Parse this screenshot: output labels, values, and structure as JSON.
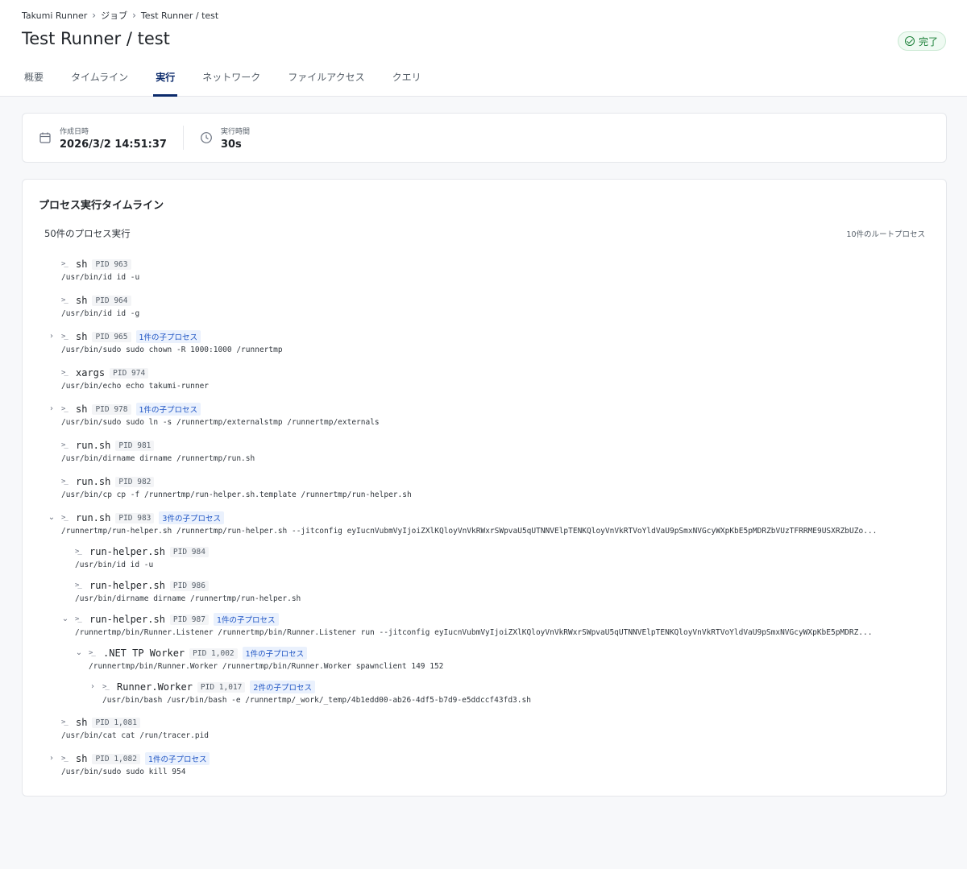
{
  "breadcrumb": {
    "items": [
      "Takumi Runner",
      "ジョブ",
      "Test Runner / test"
    ]
  },
  "page": {
    "title": "Test Runner / test",
    "status": "完了"
  },
  "tabs": [
    "概要",
    "タイムライン",
    "実行",
    "ネットワーク",
    "ファイルアクセス",
    "クエリ"
  ],
  "active_tab": "実行",
  "meta": {
    "created_label": "作成日時",
    "created_value": "2026/3/2 14:51:37",
    "duration_label": "実行時間",
    "duration_value": "30s"
  },
  "timeline": {
    "title": "プロセス実行タイムライン",
    "count": "50件のプロセス実行",
    "roots": "10件のルートプロセス",
    "processes": [
      {
        "name": "sh",
        "pid": "PID 963",
        "children": "",
        "cmd": "/usr/bin/id id -u",
        "toggle": ""
      },
      {
        "name": "sh",
        "pid": "PID 964",
        "children": "",
        "cmd": "/usr/bin/id id -g",
        "toggle": ""
      },
      {
        "name": "sh",
        "pid": "PID 965",
        "children": "1件の子プロセス",
        "cmd": "/usr/bin/sudo sudo chown -R 1000:1000 /runnertmp",
        "toggle": "›"
      },
      {
        "name": "xargs",
        "pid": "PID 974",
        "children": "",
        "cmd": "/usr/bin/echo echo takumi-runner",
        "toggle": ""
      },
      {
        "name": "sh",
        "pid": "PID 978",
        "children": "1件の子プロセス",
        "cmd": "/usr/bin/sudo sudo ln -s /runnertmp/externalstmp /runnertmp/externals",
        "toggle": "›"
      },
      {
        "name": "run.sh",
        "pid": "PID 981",
        "children": "",
        "cmd": "/usr/bin/dirname dirname /runnertmp/run.sh",
        "toggle": ""
      },
      {
        "name": "run.sh",
        "pid": "PID 982",
        "children": "",
        "cmd": "/usr/bin/cp cp -f /runnertmp/run-helper.sh.template /runnertmp/run-helper.sh",
        "toggle": ""
      },
      {
        "name": "run.sh",
        "pid": "PID 983",
        "children": "3件の子プロセス",
        "cmd": "/runnertmp/run-helper.sh /runnertmp/run-helper.sh --jitconfig eyIucnVubmVyIjoiZXlKQloyVnVkRWxrSWpvaU5qUTNNVElpTENKQloyVnVkRTVoYldVaU9pSmxNVGcyWXpKbE5pMDRZbVUzTFRRME9USXRZbUZo...",
        "toggle": "⌄"
      },
      {
        "name": "run-helper.sh",
        "pid": "PID 984",
        "children": "",
        "cmd": "/usr/bin/id id -u",
        "toggle": ""
      },
      {
        "name": "run-helper.sh",
        "pid": "PID 986",
        "children": "",
        "cmd": "/usr/bin/dirname dirname /runnertmp/run-helper.sh",
        "toggle": ""
      },
      {
        "name": "run-helper.sh",
        "pid": "PID 987",
        "children": "1件の子プロセス",
        "cmd": "/runnertmp/bin/Runner.Listener /runnertmp/bin/Runner.Listener run --jitconfig eyIucnVubmVyIjoiZXlKQloyVnVkRWxrSWpvaU5qUTNNVElpTENKQloyVnVkRTVoYldVaU9pSmxNVGcyWXpKbE5pMDRZ...",
        "toggle": "⌄"
      },
      {
        "name": ".NET TP Worker",
        "pid": "PID 1,002",
        "children": "1件の子プロセス",
        "cmd": "/runnertmp/bin/Runner.Worker /runnertmp/bin/Runner.Worker spawnclient 149 152",
        "toggle": "⌄"
      },
      {
        "name": "Runner.Worker",
        "pid": "PID 1,017",
        "children": "2件の子プロセス",
        "cmd": "/usr/bin/bash /usr/bin/bash -e /runnertmp/_work/_temp/4b1edd00-ab26-4df5-b7d9-e5ddccf43fd3.sh",
        "toggle": "›"
      },
      {
        "name": "sh",
        "pid": "PID 1,081",
        "children": "",
        "cmd": "/usr/bin/cat cat /run/tracer.pid",
        "toggle": ""
      },
      {
        "name": "sh",
        "pid": "PID 1,082",
        "children": "1件の子プロセス",
        "cmd": "/usr/bin/sudo sudo kill 954",
        "toggle": "›"
      }
    ]
  }
}
